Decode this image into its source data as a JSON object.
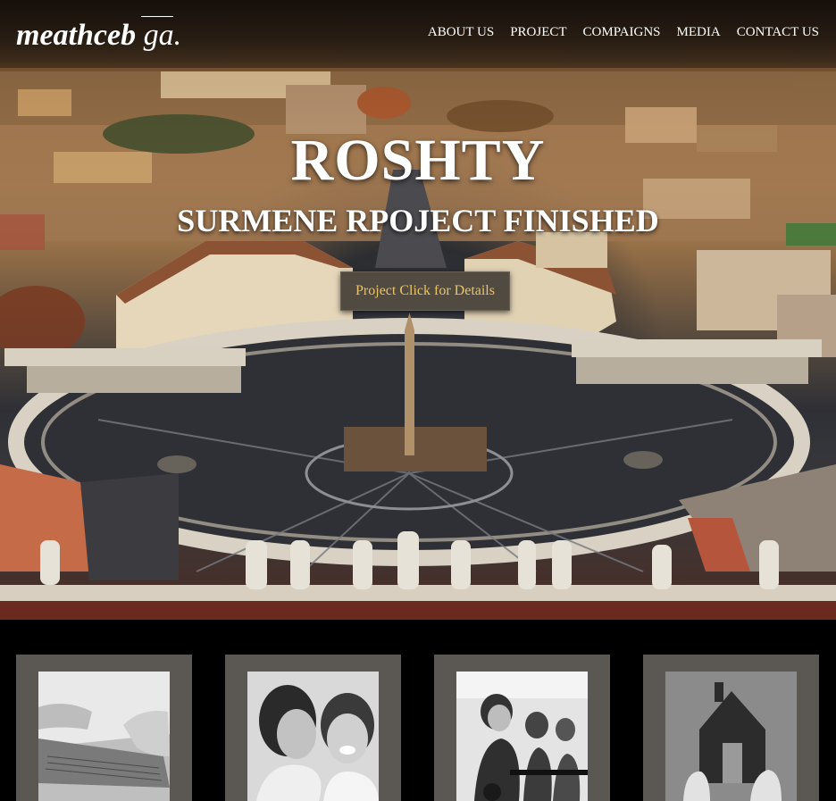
{
  "header": {
    "logo_main": "meathceb",
    "logo_suffix": "ga.",
    "nav": [
      {
        "label": "ABOUT US"
      },
      {
        "label": "PROJECT"
      },
      {
        "label": "COMPAIGNS"
      },
      {
        "label": "MEDIA"
      },
      {
        "label": "CONTACT US"
      }
    ]
  },
  "hero": {
    "title": "ROSHTY",
    "subtitle": "SURMENE RPOJECT FINISHED",
    "cta_label": "Project Click for Details"
  },
  "cards": [
    {
      "image": "laptop-typing-photo"
    },
    {
      "image": "women-whispering-photo"
    },
    {
      "image": "spinning-class-photo"
    },
    {
      "image": "house-in-hands-photo"
    }
  ],
  "colors": {
    "cta_text": "#e9c46a",
    "cta_bg": "#514a41",
    "card_frame": "#5b5753",
    "page_bg": "#000000"
  }
}
